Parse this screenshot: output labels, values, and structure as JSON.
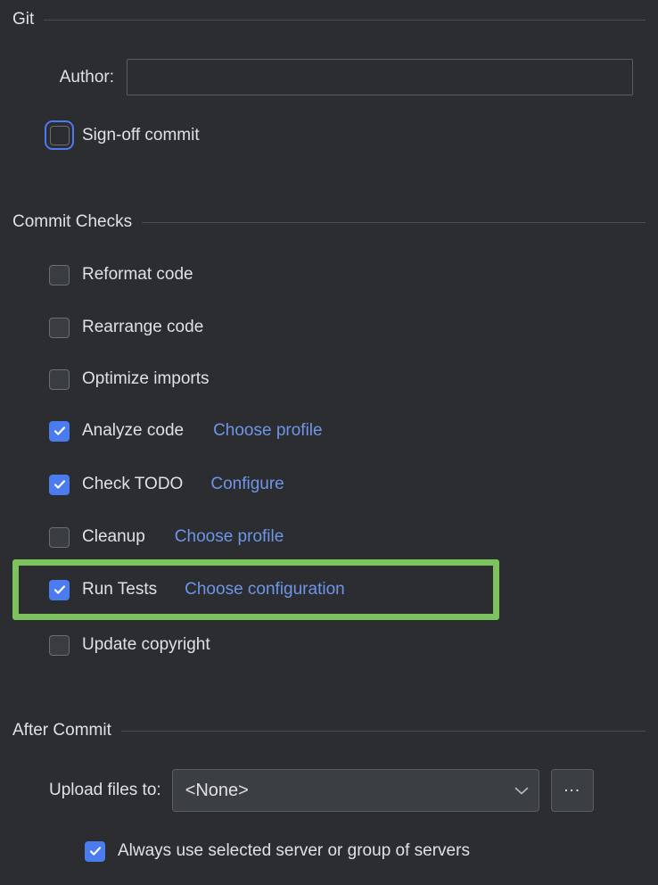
{
  "sections": {
    "git": {
      "title": "Git",
      "author": {
        "label": "Author:",
        "value": "",
        "placeholder": ""
      },
      "signoff": {
        "label": "Sign-off commit",
        "checked": false,
        "focused": true
      }
    },
    "commit_checks": {
      "title": "Commit Checks",
      "items": [
        {
          "label": "Reformat code",
          "checked": false,
          "link": ""
        },
        {
          "label": "Rearrange code",
          "checked": false,
          "link": ""
        },
        {
          "label": "Optimize imports",
          "checked": false,
          "link": ""
        },
        {
          "label": "Analyze code",
          "checked": true,
          "link": "Choose profile"
        },
        {
          "label": "Check TODO",
          "checked": true,
          "link": "Configure"
        },
        {
          "label": "Cleanup",
          "checked": false,
          "link": "Choose profile"
        },
        {
          "label": "Run Tests",
          "checked": true,
          "link": "Choose configuration"
        },
        {
          "label": "Update copyright",
          "checked": false,
          "link": ""
        }
      ]
    },
    "after_commit": {
      "title": "After Commit",
      "upload": {
        "label": "Upload files to:",
        "value": "<None>",
        "more_button": "..."
      },
      "always_use": {
        "label": "Always use selected server or group of servers",
        "checked": true
      }
    }
  },
  "highlight": {
    "target": "Run Tests",
    "color": "#7cc35d"
  },
  "colors": {
    "background": "#2b2d30",
    "text": "#dfe1e5",
    "link": "#6e95e8",
    "checkbox_accent": "#4a7bef",
    "highlight": "#7cc35d",
    "separator": "#4a4d51",
    "control_background": "#3c3f41",
    "control_border": "#5a5d63"
  }
}
